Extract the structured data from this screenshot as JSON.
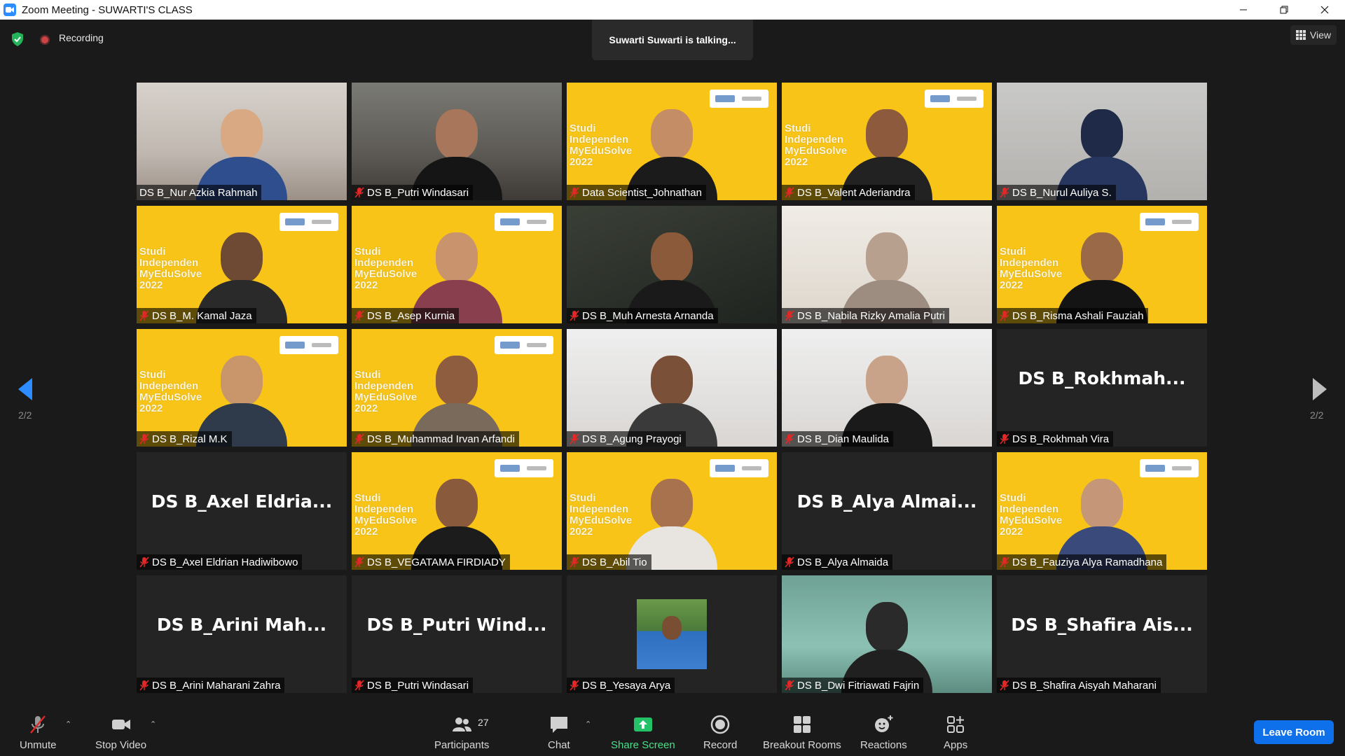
{
  "window": {
    "title": "Zoom Meeting - SUWARTI'S CLASS",
    "controls": [
      "minimize",
      "restore",
      "close"
    ]
  },
  "header": {
    "recording_label": "Recording",
    "talking_banner": "Suwarti Suwarti is talking...",
    "view_label": "View"
  },
  "gallery": {
    "page_indicator": "2/2",
    "vb_text": "Studi\nIndependen\nMyEduSolve\n2022",
    "tiles": [
      {
        "name": "DS B_Nur Azkia Rahmah",
        "muted": false,
        "big_label": ""
      },
      {
        "name": "DS B_Putri Windasari",
        "muted": true,
        "big_label": ""
      },
      {
        "name": "Data Scientist_Johnathan",
        "muted": true,
        "big_label": ""
      },
      {
        "name": "DS B_Valent Aderiandra",
        "muted": true,
        "big_label": ""
      },
      {
        "name": "DS B_Nurul Auliya S.",
        "muted": true,
        "big_label": ""
      },
      {
        "name": "DS B_M. Kamal Jaza",
        "muted": true,
        "big_label": ""
      },
      {
        "name": "DS B_Asep Kurnia",
        "muted": true,
        "big_label": ""
      },
      {
        "name": "DS B_Muh Arnesta Arnanda",
        "muted": true,
        "big_label": ""
      },
      {
        "name": "DS B_Nabila Rizky Amalia Putri",
        "muted": true,
        "big_label": ""
      },
      {
        "name": "DS B_Risma Ashali Fauziah",
        "muted": true,
        "big_label": ""
      },
      {
        "name": "DS B_Rizal M.K",
        "muted": true,
        "big_label": ""
      },
      {
        "name": "DS B_Muhammad Irvan Arfandi",
        "muted": true,
        "big_label": ""
      },
      {
        "name": "DS B_Agung Prayogi",
        "muted": true,
        "big_label": ""
      },
      {
        "name": "DS B_Dian Maulida",
        "muted": true,
        "big_label": ""
      },
      {
        "name": "DS B_Rokhmah Vira",
        "muted": true,
        "big_label": "DS B_Rokhmah..."
      },
      {
        "name": "DS B_Axel Eldrian Hadiwibowo",
        "muted": true,
        "big_label": "DS B_Axel Eldria..."
      },
      {
        "name": "DS B_VEGATAMA FIRDIADY",
        "muted": true,
        "big_label": ""
      },
      {
        "name": "DS B_Abil Tio",
        "muted": true,
        "big_label": ""
      },
      {
        "name": "DS B_Alya Almaida",
        "muted": true,
        "big_label": "DS B_Alya Almai..."
      },
      {
        "name": "DS B_Fauziya Alya Ramadhana",
        "muted": true,
        "big_label": ""
      },
      {
        "name": "DS B_Arini Maharani Zahra",
        "muted": true,
        "big_label": "DS B_Arini Mah..."
      },
      {
        "name": "DS B_Putri Windasari",
        "muted": true,
        "big_label": "DS B_Putri Wind..."
      },
      {
        "name": "DS B_Yesaya Arya",
        "muted": true,
        "big_label": ""
      },
      {
        "name": "DS B_Dwi Fitriawati Fajrin",
        "muted": true,
        "big_label": ""
      },
      {
        "name": "DS B_Shafira Aisyah Maharani",
        "muted": true,
        "big_label": "DS B_Shafira Ais..."
      }
    ]
  },
  "toolbar": {
    "unmute": "Unmute",
    "stop_video": "Stop Video",
    "participants": "Participants",
    "participants_count": "27",
    "chat": "Chat",
    "share_screen": "Share Screen",
    "record": "Record",
    "breakout_rooms": "Breakout Rooms",
    "reactions": "Reactions",
    "apps": "Apps",
    "leave": "Leave Room"
  },
  "colors": {
    "accent_blue": "#0e71eb",
    "share_green": "#4ae089",
    "vb_yellow": "#f7c417",
    "mute_red": "#e02828"
  }
}
